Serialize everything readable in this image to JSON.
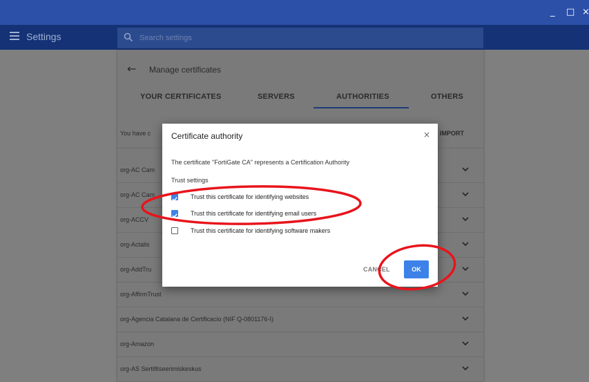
{
  "window_controls": {
    "minimize": "_",
    "maximize": "□",
    "close": "×"
  },
  "app": {
    "title": "Settings"
  },
  "search": {
    "placeholder": "Search settings"
  },
  "panel": {
    "title": "Manage certificates",
    "tabs": [
      "YOUR CERTIFICATES",
      "SERVERS",
      "AUTHORITIES",
      "OTHERS"
    ],
    "active_tab": "AUTHORITIES",
    "intro_text": "You have c",
    "import_label": "IMPORT",
    "rows": [
      "org-AC Cam",
      "org-AC Cam",
      "org-ACCV",
      "org-Actalis",
      "org-AddTru",
      "org-AffirmTrust",
      "org-Agencia Catalana de Certificacio (NIF Q-0801176-I)",
      "org-Amazon",
      "org-AS Sertifitseerimiskeskus"
    ]
  },
  "dialog": {
    "title": "Certificate authority",
    "close_glyph": "×",
    "message": "The certificate \"FortiGate CA\" represents a Certification Authority",
    "trust_heading": "Trust settings",
    "options": [
      {
        "label": "Trust this certificate for identifying websites",
        "checked": true
      },
      {
        "label": "Trust this certificate for identifying email users",
        "checked": true
      },
      {
        "label": "Trust this certificate for identifying software makers",
        "checked": false
      }
    ],
    "cancel_label": "CANCEL",
    "ok_label": "OK"
  },
  "colors": {
    "titlebar": "#2c50a8",
    "appbar": "#143275",
    "accent": "#3c82e8",
    "annotation_red": "#e8141c"
  }
}
